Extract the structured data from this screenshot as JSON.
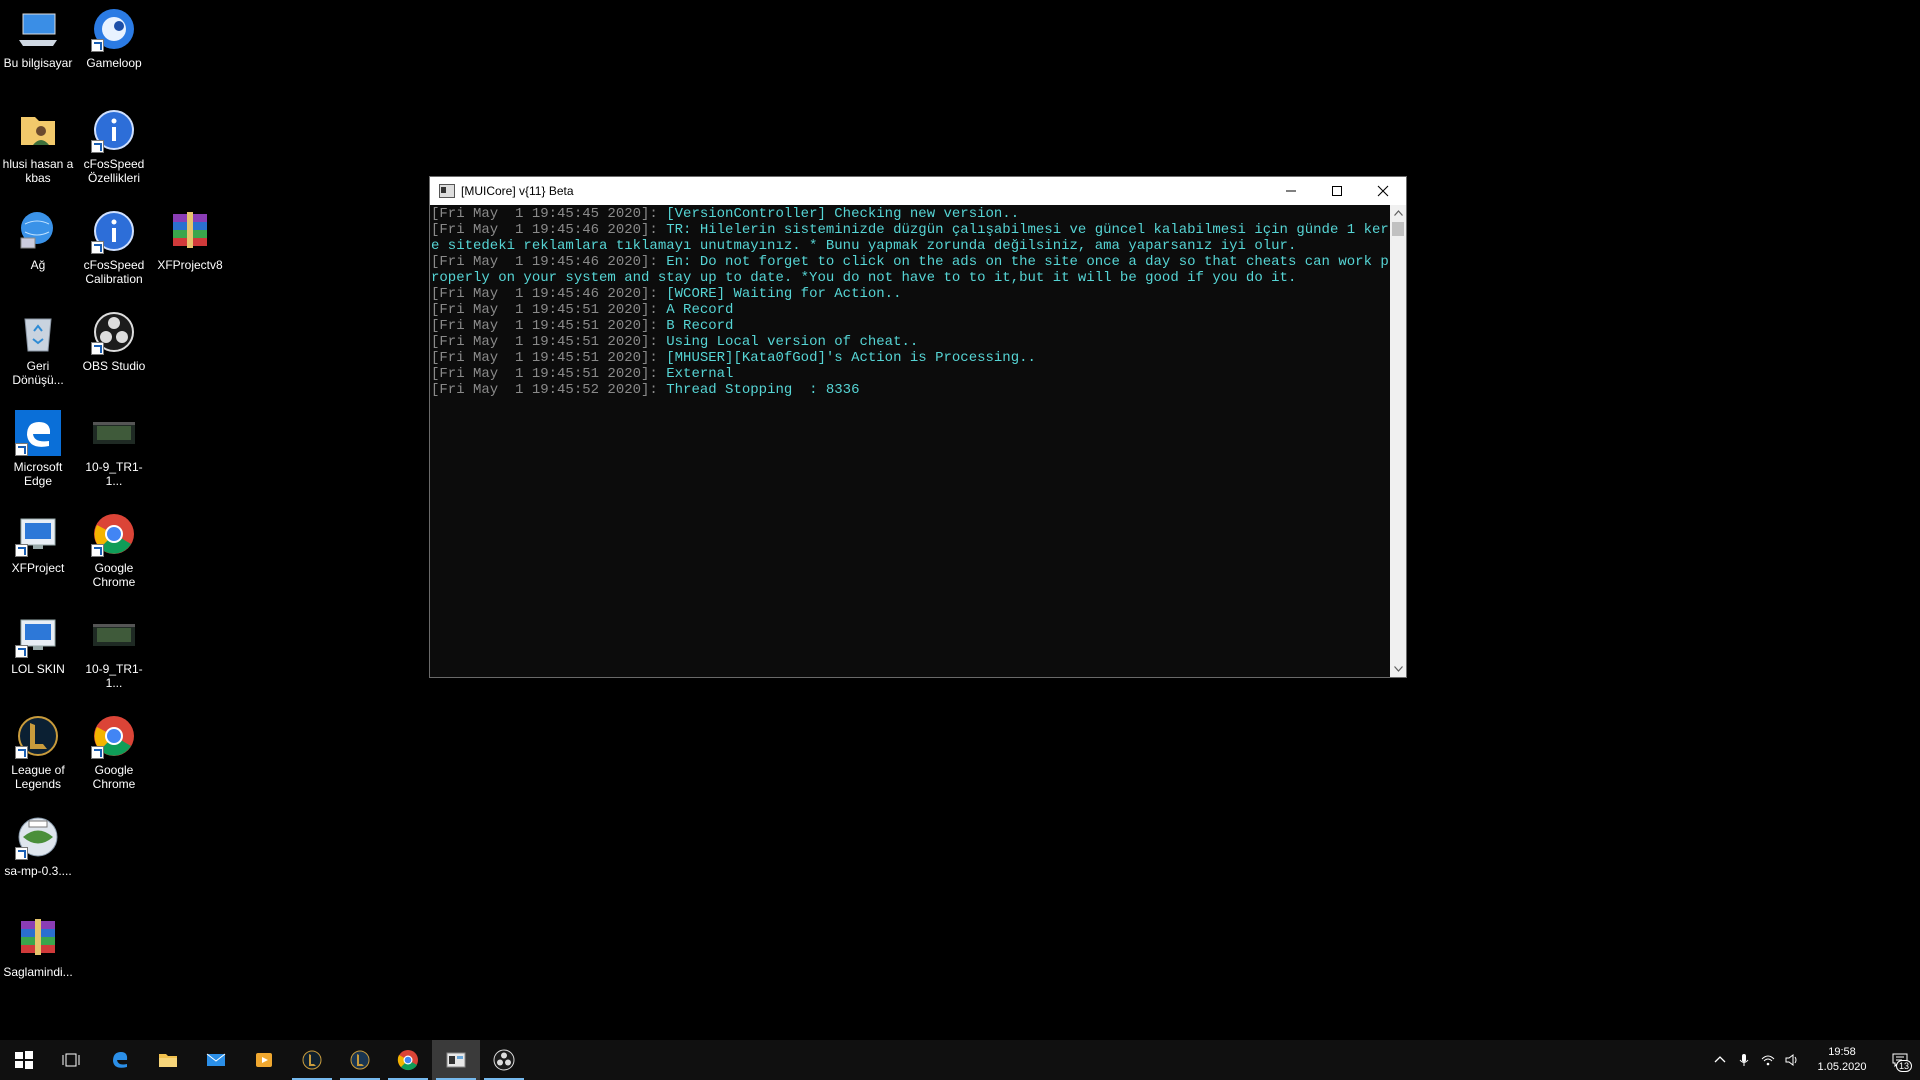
{
  "desktop": {
    "icons": [
      {
        "label": "Bu bilgisayar",
        "icon": "computer-icon"
      },
      {
        "label": "Gameloop",
        "icon": "gameloop-icon"
      },
      {
        "label": "hlusi hasan a kbas",
        "icon": "user-folder-icon"
      },
      {
        "label": "cFosSpeed Özellikleri",
        "icon": "info-icon"
      },
      {
        "label": "Ağ",
        "icon": "network-icon"
      },
      {
        "label": "cFosSpeed Calibration",
        "icon": "info-icon"
      },
      {
        "label": "XFProjectv8",
        "icon": "winrar-icon"
      },
      {
        "label": "Geri Dönüşü...",
        "icon": "recycle-bin-icon"
      },
      {
        "label": "OBS Studio",
        "icon": "obs-icon"
      },
      {
        "label": "Microsoft Edge",
        "icon": "edge-icon"
      },
      {
        "label": "10-9_TR1-1...",
        "icon": "video-file-icon"
      },
      {
        "label": "XFProject",
        "icon": "app-icon"
      },
      {
        "label": "Google Chrome",
        "icon": "chrome-icon"
      },
      {
        "label": "LOL SKIN",
        "icon": "app-icon"
      },
      {
        "label": "10-9_TR1-1...",
        "icon": "video-file-icon"
      },
      {
        "label": "League of Legends",
        "icon": "league-icon"
      },
      {
        "label": "Google Chrome",
        "icon": "chrome-icon"
      },
      {
        "label": "sa-mp-0.3....",
        "icon": "samp-icon"
      },
      {
        "label": "Saglamindi...",
        "icon": "winrar-icon"
      }
    ]
  },
  "window": {
    "title": "[MUICore] v{11} Beta",
    "minimize_icon": "minimize-icon",
    "maximize_icon": "maximize-icon",
    "close_icon": "close-icon"
  },
  "console": {
    "lines": [
      {
        "ts": "[Fri May  1 19:45:45 2020]: ",
        "msg": "[VersionController] Checking new version.."
      },
      {
        "ts": "[Fri May  1 19:45:46 2020]: ",
        "msg": "TR: Hilelerin sisteminizde düzgün çalışabilmesi ve güncel kalabilmesi için günde 1 kere sitedeki reklamlara tıklamayı unutmayınız. * Bunu yapmak zorunda değilsiniz, ama yaparsanız iyi olur."
      },
      {
        "ts": "[Fri May  1 19:45:46 2020]: ",
        "msg": "En: Do not forget to click on the ads on the site once a day so that cheats can work properly on your system and stay up to date. *You do not have to to it,but it will be good if you do it."
      },
      {
        "ts": "[Fri May  1 19:45:46 2020]: ",
        "msg": "[WCORE] Waiting for Action.."
      },
      {
        "ts": "[Fri May  1 19:45:51 2020]: ",
        "msg": "A Record"
      },
      {
        "ts": "[Fri May  1 19:45:51 2020]: ",
        "msg": "B Record"
      },
      {
        "ts": "[Fri May  1 19:45:51 2020]: ",
        "msg": "Using Local version of cheat.."
      },
      {
        "ts": "[Fri May  1 19:45:51 2020]: ",
        "msg": "[MHUSER][Kata0fGod]'s Action is Processing.."
      },
      {
        "ts": "[Fri May  1 19:45:51 2020]: ",
        "msg": "External"
      },
      {
        "ts": "[Fri May  1 19:45:52 2020]: ",
        "msg": "Thread Stopping  : 8336"
      }
    ]
  },
  "taskbar": {
    "apps": [
      {
        "icon": "windows-start-icon",
        "active": false
      },
      {
        "icon": "task-view-icon",
        "active": false
      },
      {
        "icon": "edge-icon",
        "active": false
      },
      {
        "icon": "file-explorer-icon",
        "active": false
      },
      {
        "icon": "mail-icon",
        "active": false
      },
      {
        "icon": "media-player-icon",
        "active": false
      },
      {
        "icon": "league-client-icon",
        "active": true
      },
      {
        "icon": "league-icon",
        "active": true
      },
      {
        "icon": "chrome-icon",
        "active": true
      },
      {
        "icon": "console-icon",
        "active": true,
        "current": true
      },
      {
        "icon": "obs-icon",
        "active": true
      }
    ],
    "clock_time": "19:58",
    "clock_date": "1.05.2020",
    "notification_count": "13",
    "accent": "#76b9ed"
  },
  "colors": {
    "console_bg": "#0c0c0c",
    "timestamp": "#8a8a8a",
    "message": "#56d5d5"
  }
}
